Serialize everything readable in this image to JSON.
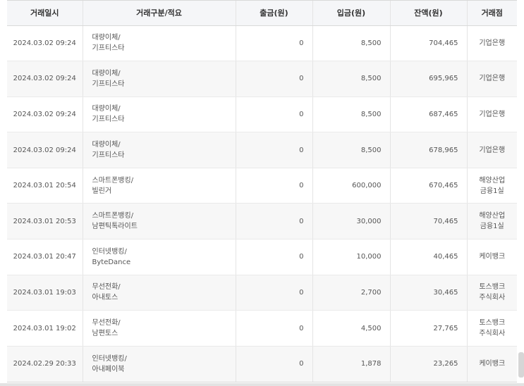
{
  "headers": [
    "거래일시",
    "거래구분/적요",
    "출금(원)",
    "입금(원)",
    "잔액(원)",
    "거래점"
  ],
  "rows": [
    {
      "datetime": "2024.03.02 09:24",
      "type": "대량이체/",
      "memo": "기프티스타",
      "withdrawal": "0",
      "deposit": "8,500",
      "balance": "704,465",
      "branch1": "기업은행",
      "branch2": ""
    },
    {
      "datetime": "2024.03.02 09:24",
      "type": "대량이체/",
      "memo": "기프티스타",
      "withdrawal": "0",
      "deposit": "8,500",
      "balance": "695,965",
      "branch1": "기업은행",
      "branch2": ""
    },
    {
      "datetime": "2024.03.02 09:24",
      "type": "대량이체/",
      "memo": "기프티스타",
      "withdrawal": "0",
      "deposit": "8,500",
      "balance": "687,465",
      "branch1": "기업은행",
      "branch2": ""
    },
    {
      "datetime": "2024.03.02 09:24",
      "type": "대량이체/",
      "memo": "기프티스타",
      "withdrawal": "0",
      "deposit": "8,500",
      "balance": "678,965",
      "branch1": "기업은행",
      "branch2": ""
    },
    {
      "datetime": "2024.03.01 20:54",
      "type": "스마트폰뱅킹/",
      "memo": "빌린거",
      "withdrawal": "0",
      "deposit": "600,000",
      "balance": "670,465",
      "branch1": "해양산업",
      "branch2": "금융1실"
    },
    {
      "datetime": "2024.03.01 20:53",
      "type": "스마트폰뱅킹/",
      "memo": "남편틱톡라이트",
      "withdrawal": "0",
      "deposit": "30,000",
      "balance": "70,465",
      "branch1": "해양산업",
      "branch2": "금융1실"
    },
    {
      "datetime": "2024.03.01 20:47",
      "type": "인터넷뱅킹/",
      "memo": "ByteDance",
      "withdrawal": "0",
      "deposit": "10,000",
      "balance": "40,465",
      "branch1": "케이뱅크",
      "branch2": ""
    },
    {
      "datetime": "2024.03.01 19:03",
      "type": "무선전화/",
      "memo": "아내토스",
      "withdrawal": "0",
      "deposit": "2,700",
      "balance": "30,465",
      "branch1": "토스뱅크",
      "branch2": "주식회사"
    },
    {
      "datetime": "2024.03.01 19:02",
      "type": "무선전화/",
      "memo": "남편토스",
      "withdrawal": "0",
      "deposit": "4,500",
      "balance": "27,765",
      "branch1": "토스뱅크",
      "branch2": "주식회사"
    },
    {
      "datetime": "2024.02.29 20:33",
      "type": "인터넷뱅킹/",
      "memo": "아내페이북",
      "withdrawal": "0",
      "deposit": "1,878",
      "balance": "23,265",
      "branch1": "케이뱅크",
      "branch2": ""
    }
  ]
}
